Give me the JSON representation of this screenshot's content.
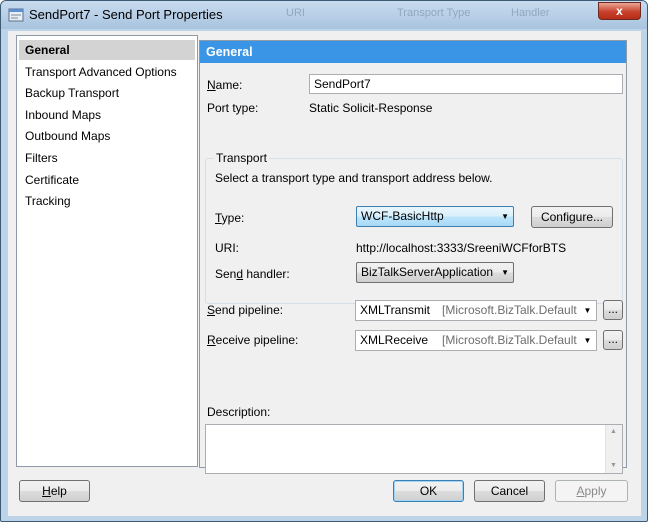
{
  "window": {
    "title": "SendPort7 - Send Port Properties",
    "close_label": "x",
    "background_ghost": [
      "URI",
      "Transport Type",
      "Handler"
    ]
  },
  "sidebar": {
    "items": [
      {
        "label": "General",
        "active": true
      },
      {
        "label": "Transport Advanced Options"
      },
      {
        "label": "Backup Transport"
      },
      {
        "label": "Inbound Maps"
      },
      {
        "label": "Outbound Maps"
      },
      {
        "label": "Filters"
      },
      {
        "label": "Certificate"
      },
      {
        "label": "Tracking"
      }
    ]
  },
  "panel": {
    "header": "General",
    "name_label": "Name:",
    "name_value": "SendPort7",
    "port_type_label": "Port type:",
    "port_type_value": "Static Solicit-Response",
    "transport": {
      "group_title": "Transport",
      "instruction": "Select a transport type and transport address below.",
      "type_label": "Type:",
      "type_value": "WCF-BasicHttp",
      "configure_label": "Configure...",
      "uri_label": "URI:",
      "uri_value": "http://localhost:3333/SreeniWCFforBTS",
      "handler_label": "Send handler:",
      "handler_value": "BizTalkServerApplication"
    },
    "send_pipeline": {
      "label": "Send pipeline:",
      "name": "XMLTransmit",
      "assembly": "[Microsoft.BizTalk.DefaultPip",
      "browse_label": "..."
    },
    "receive_pipeline": {
      "label": "Receive pipeline:",
      "name": "XMLReceive",
      "assembly": "[Microsoft.BizTalk.DefaultPip",
      "browse_label": "..."
    },
    "description_label": "Description:",
    "description_value": ""
  },
  "footer": {
    "help_label": "Help",
    "ok_label": "OK",
    "cancel_label": "Cancel",
    "apply_label": "Apply"
  },
  "colors": {
    "header_blue": "#3b95e6",
    "selected_item": "#d3d3d3",
    "close_red": "#c8412c"
  }
}
